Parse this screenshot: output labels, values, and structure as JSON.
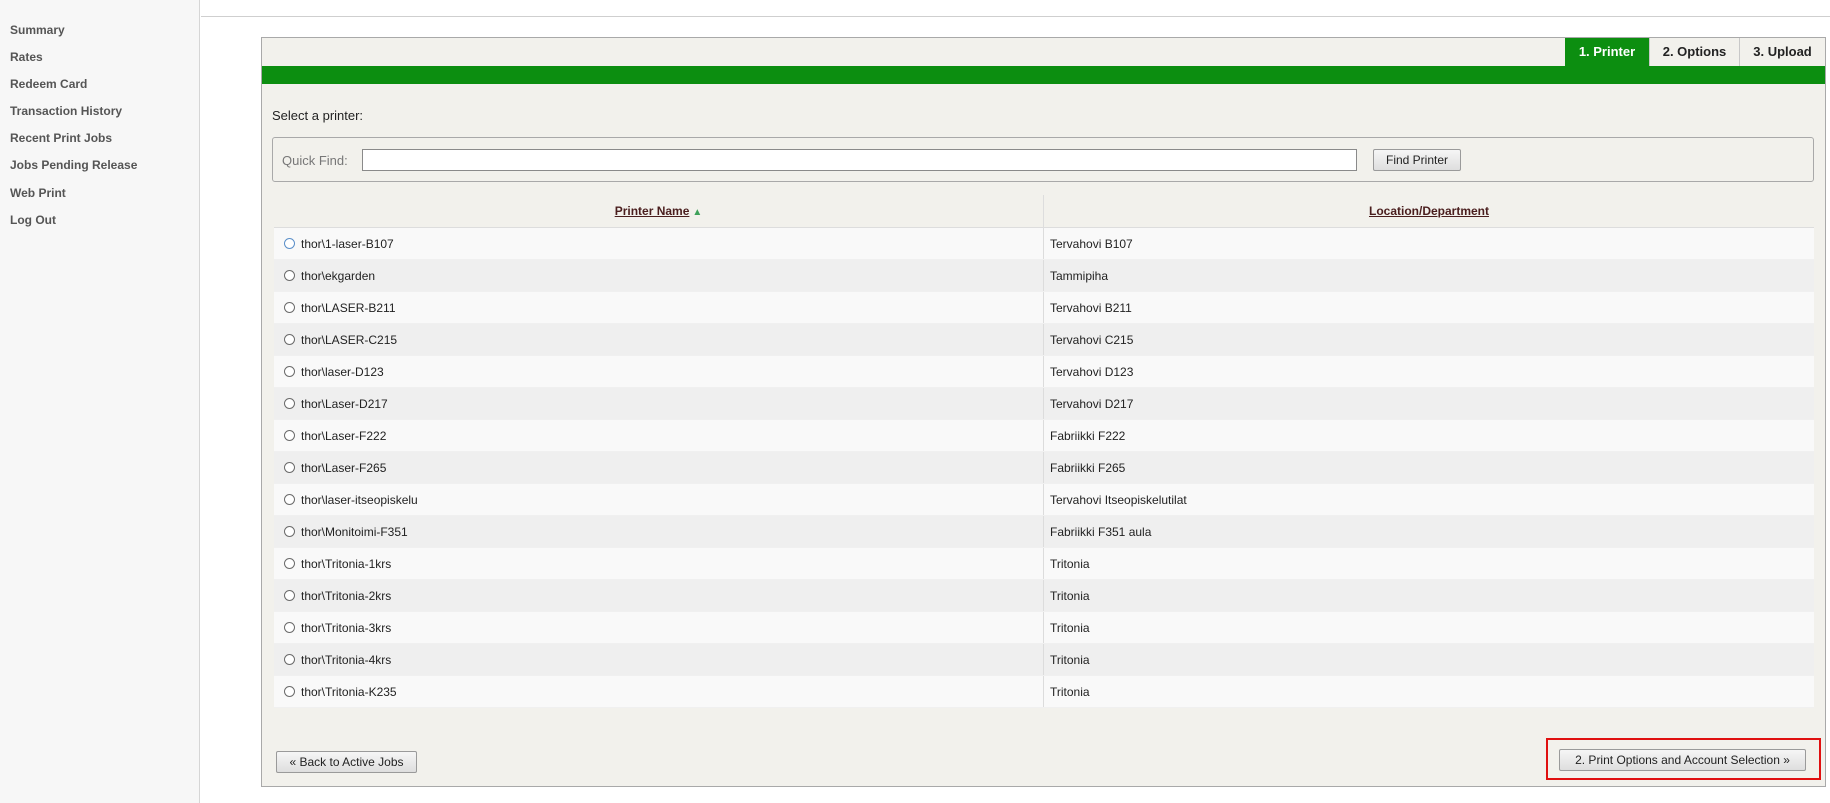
{
  "sidebar": {
    "items": [
      {
        "label": "Summary"
      },
      {
        "label": "Rates"
      },
      {
        "label": "Redeem Card"
      },
      {
        "label": "Transaction History"
      },
      {
        "label": "Recent Print Jobs"
      },
      {
        "label": "Jobs Pending Release"
      },
      {
        "label": "Web Print"
      },
      {
        "label": "Log Out"
      }
    ]
  },
  "steps": [
    {
      "label": "1. Printer",
      "active": true
    },
    {
      "label": "2. Options",
      "active": false
    },
    {
      "label": "3. Upload",
      "active": false
    }
  ],
  "accent_color": "#0c8e10",
  "highlight_color": "#e01010",
  "main": {
    "select_label": "Select a printer:",
    "quick_find": {
      "label": "Quick Find:",
      "value": "",
      "placeholder": ""
    },
    "find_button": "Find Printer",
    "table": {
      "headers": {
        "printer_name": "Printer Name",
        "location": "Location/Department"
      },
      "sort_icon": "sort-ascending-icon",
      "rows": [
        {
          "printer": "thor\\1-laser-B107",
          "location": "Tervahovi B107"
        },
        {
          "printer": "thor\\ekgarden",
          "location": "Tammipiha"
        },
        {
          "printer": "thor\\LASER-B211",
          "location": "Tervahovi B211"
        },
        {
          "printer": "thor\\LASER-C215",
          "location": "Tervahovi C215"
        },
        {
          "printer": "thor\\laser-D123",
          "location": "Tervahovi D123"
        },
        {
          "printer": "thor\\Laser-D217",
          "location": "Tervahovi D217"
        },
        {
          "printer": "thor\\Laser-F222",
          "location": "Fabriikki F222"
        },
        {
          "printer": "thor\\Laser-F265",
          "location": "Fabriikki F265"
        },
        {
          "printer": "thor\\laser-itseopiskelu",
          "location": "Tervahovi Itseopiskelutilat"
        },
        {
          "printer": "thor\\Monitoimi-F351",
          "location": "Fabriikki F351 aula"
        },
        {
          "printer": "thor\\Tritonia-1krs",
          "location": "Tritonia"
        },
        {
          "printer": "thor\\Tritonia-2krs",
          "location": "Tritonia"
        },
        {
          "printer": "thor\\Tritonia-3krs",
          "location": "Tritonia"
        },
        {
          "printer": "thor\\Tritonia-4krs",
          "location": "Tritonia"
        },
        {
          "printer": "thor\\Tritonia-K235",
          "location": "Tritonia"
        }
      ]
    },
    "back_button": "« Back to Active Jobs",
    "next_button": "2. Print Options and Account Selection »"
  }
}
